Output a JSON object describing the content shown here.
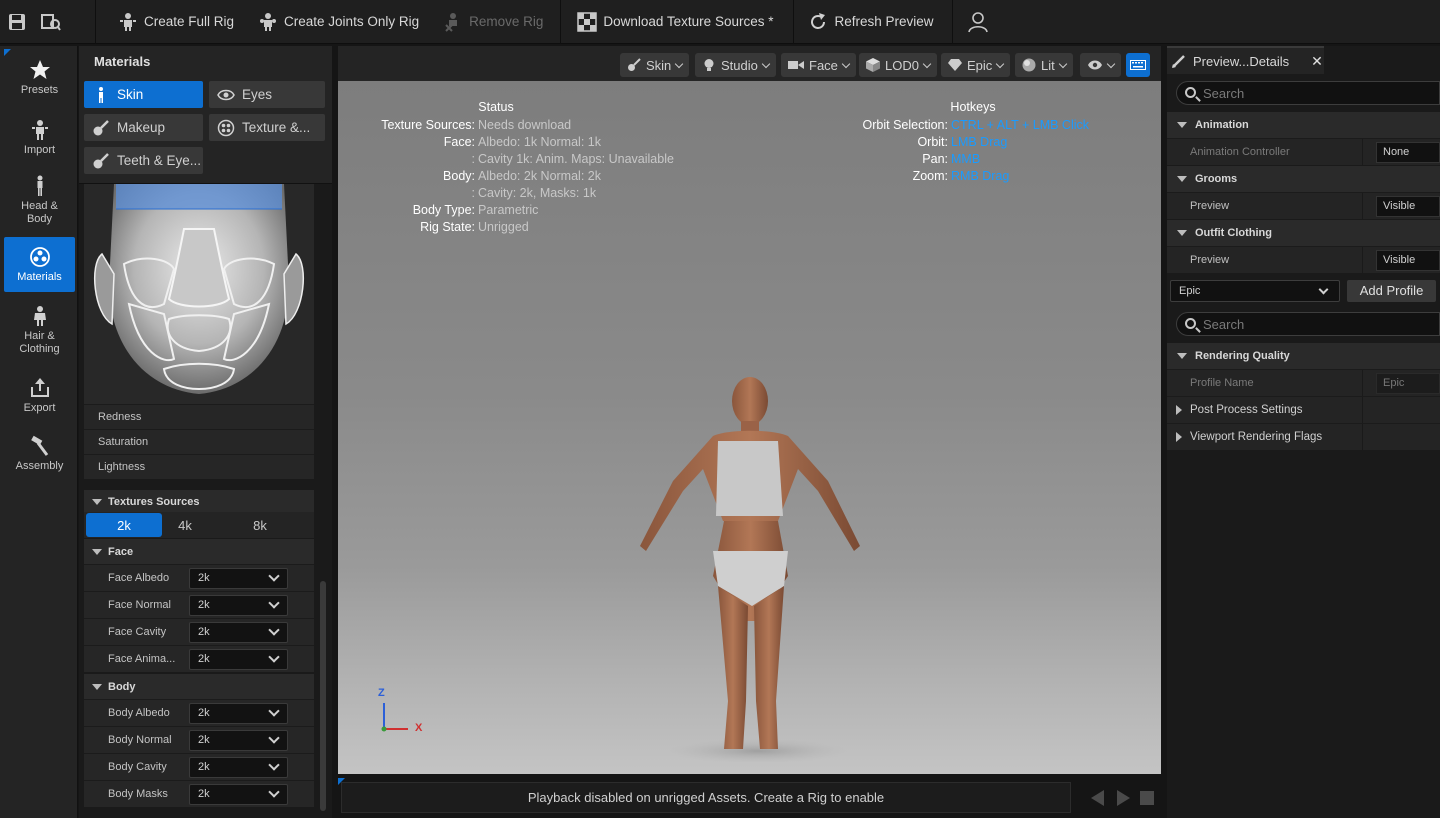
{
  "toolbar": {
    "create_full_rig": "Create Full Rig",
    "create_joints_only_rig": "Create Joints Only Rig",
    "remove_rig": "Remove Rig",
    "download_texture_sources": "Download Texture Sources *",
    "refresh_preview": "Refresh Preview"
  },
  "nav": {
    "presets": "Presets",
    "import": "Import",
    "head_body": "Head &\nBody",
    "materials": "Materials",
    "hair_clothing": "Hair &\nClothing",
    "export": "Export",
    "assembly": "Assembly"
  },
  "materials_panel": {
    "title": "Materials",
    "tabs": {
      "skin": "Skin",
      "eyes": "Eyes",
      "makeup": "Makeup",
      "texture": "Texture &...",
      "teeth": "Teeth & Eye..."
    },
    "sliders": {
      "redness": "Redness",
      "saturation": "Saturation",
      "lightness": "Lightness"
    },
    "textures_sources": {
      "title": "Textures Sources",
      "resolutions": [
        "2k",
        "4k",
        "8k"
      ],
      "selected": "2k"
    },
    "face": {
      "title": "Face",
      "rows": [
        {
          "label": "Face Albedo",
          "value": "2k"
        },
        {
          "label": "Face Normal",
          "value": "2k"
        },
        {
          "label": "Face Cavity",
          "value": "2k"
        },
        {
          "label": "Face Anima...",
          "value": "2k"
        }
      ]
    },
    "body": {
      "title": "Body",
      "rows": [
        {
          "label": "Body Albedo",
          "value": "2k"
        },
        {
          "label": "Body Normal",
          "value": "2k"
        },
        {
          "label": "Body Cavity",
          "value": "2k"
        },
        {
          "label": "Body Masks",
          "value": "2k"
        }
      ]
    }
  },
  "viewport": {
    "toolbar": {
      "skin": "Skin",
      "studio": "Studio",
      "face": "Face",
      "lod": "LOD0",
      "quality": "Epic",
      "lit": "Lit"
    },
    "status": {
      "title": "Status",
      "rows": [
        {
          "label": "Texture Sources:",
          "value": "Needs download"
        },
        {
          "label": "Face:",
          "value": "Albedo: 1k Normal: 1k"
        },
        {
          "label": ":",
          "value": "Cavity 1k: Anim. Maps: Unavailable"
        },
        {
          "label": "Body:",
          "value": "Albedo: 2k Normal: 2k"
        },
        {
          "label": ":",
          "value": "Cavity: 2k, Masks: 1k"
        },
        {
          "label": "Body Type:",
          "value": "Parametric"
        },
        {
          "label": "Rig State:",
          "value": "Unrigged"
        }
      ]
    },
    "hotkeys": {
      "title": "Hotkeys",
      "rows": [
        {
          "label": "Orbit Selection:",
          "value": "CTRL + ALT + LMB Click"
        },
        {
          "label": "Orbit:",
          "value": "LMB Drag"
        },
        {
          "label": "Pan:",
          "value": "MMB"
        },
        {
          "label": "Zoom:",
          "value": "RMB Drag"
        }
      ]
    },
    "axis": {
      "z": "Z",
      "x": "X"
    },
    "playback_message": "Playback disabled on unrigged Assets. Create a Rig to enable"
  },
  "details": {
    "tab_title": "Preview...Details",
    "search_placeholder": "Search",
    "animation": {
      "title": "Animation",
      "controller_label": "Animation Controller",
      "controller_value": "None"
    },
    "grooms": {
      "title": "Grooms",
      "preview_label": "Preview",
      "preview_value": "Visible"
    },
    "outfit": {
      "title": "Outfit Clothing",
      "preview_label": "Preview",
      "preview_value": "Visible"
    },
    "profile_select": "Epic",
    "add_profile": "Add Profile",
    "search2_placeholder": "Search",
    "rendering_quality": {
      "title": "Rendering Quality",
      "profile_name_label": "Profile Name",
      "profile_name_value": "Epic"
    },
    "post_process": "Post Process Settings",
    "viewport_flags": "Viewport Rendering Flags"
  },
  "colors": {
    "accent": "#0d6fd1",
    "hotkey": "#1a9bff"
  }
}
